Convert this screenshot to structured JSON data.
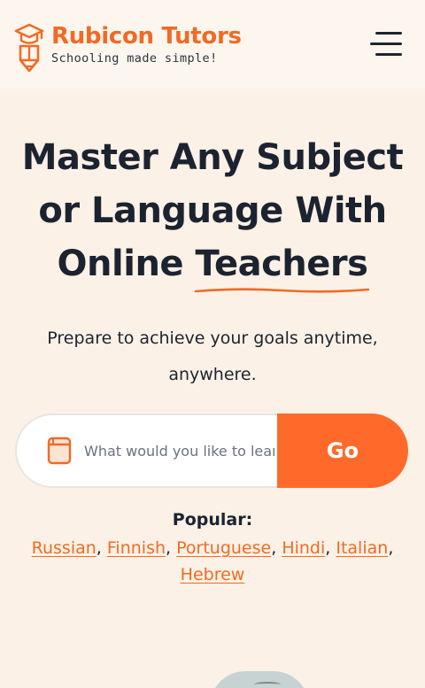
{
  "brand": {
    "name": "Rubicon Tutors",
    "tagline": "Schooling made simple!",
    "color": "#f26a24"
  },
  "header": {
    "menu_icon": "hamburger-menu-icon"
  },
  "hero": {
    "headline_part1": "Master Any Subject or Language With Online",
    "headline_highlight": "Teachers",
    "subtitle": "Prepare to achieve your goals anytime, anywhere."
  },
  "search": {
    "icon": "book-icon",
    "placeholder": "What would you like to learn?",
    "value": "",
    "button_label": "Go",
    "button_color": "#ff6a2b"
  },
  "popular": {
    "title": "Popular:",
    "links": [
      "Russian",
      "Finnish",
      "Portuguese",
      "Hindi",
      "Italian",
      "Hebrew"
    ]
  }
}
